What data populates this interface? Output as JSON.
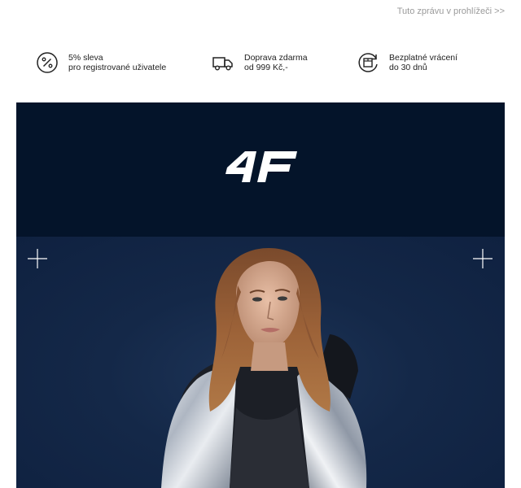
{
  "header": {
    "view_in_browser": "Tuto zprávu v prohlížeči >>"
  },
  "benefits": [
    {
      "icon": "percent-icon",
      "line1": "5% sleva",
      "line2": "pro registrované uživatele"
    },
    {
      "icon": "truck-icon",
      "line1": "Doprava zdarma",
      "line2": "od 999 Kč,-"
    },
    {
      "icon": "return-box-icon",
      "line1": "Bezplatné vrácení",
      "line2": "do 30 dnů"
    }
  ],
  "hero": {
    "brand_logo": "4F",
    "colors": {
      "logo_band": "#04142a",
      "photo_background": "#142848",
      "logo": "#ffffff"
    }
  }
}
